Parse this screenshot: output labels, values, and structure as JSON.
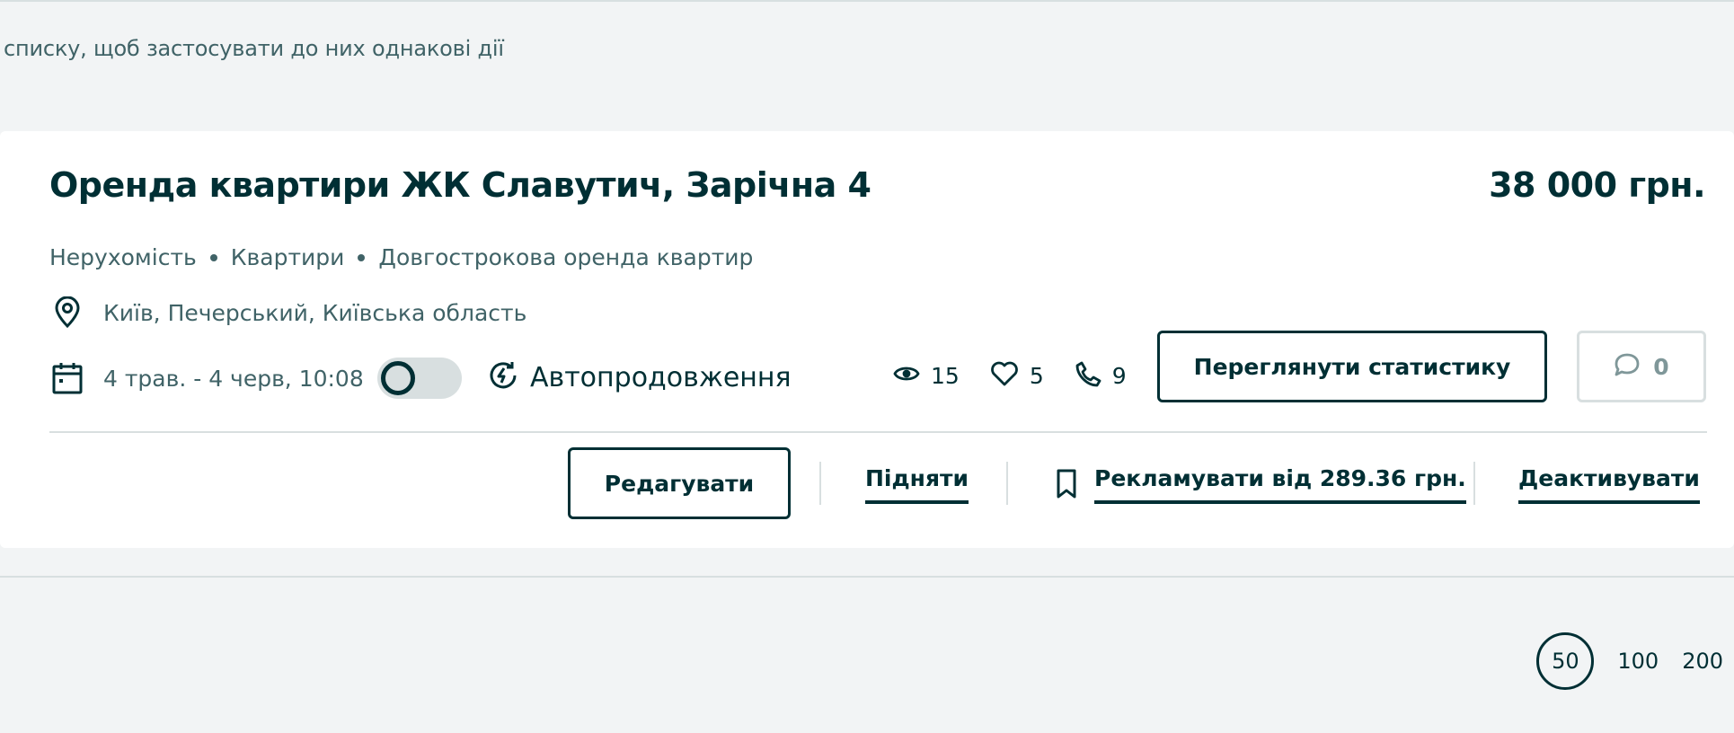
{
  "hint_text": "списку, щоб застосувати до них однакові дії",
  "listing": {
    "title": "Оренда квартири ЖК Славутич, Зарічна 4",
    "price": "38 000 грн.",
    "breadcrumbs": [
      "Нерухомість",
      "Квартири",
      "Довгострокова оренда квартир"
    ],
    "location": "Київ, Печерський, Київська область",
    "dates": "4 трав. - 4 черв, 10:08",
    "autorenew_label": "Автопродовження",
    "autorenew_enabled": false,
    "stats": {
      "views": "15",
      "favorites": "5",
      "calls": "9"
    },
    "messages_count": "0",
    "buttons": {
      "view_stats": "Переглянути статистику",
      "edit": "Редагувати",
      "raise": "Підняти",
      "promote": "Рекламувати від 289.36 грн.",
      "deactivate": "Деактивувати"
    }
  },
  "page_size": {
    "options": [
      "50",
      "100",
      "200"
    ],
    "selected": "50"
  },
  "icons": [
    "location-pin-icon",
    "calendar-icon",
    "autorenew-icon",
    "eye-icon",
    "heart-icon",
    "phone-icon",
    "chat-bubble-icon",
    "bookmark-icon"
  ],
  "colors": {
    "text_primary": "#002f34",
    "text_secondary": "#406367",
    "border_light": "#d8dfe0",
    "background": "#f2f4f5"
  }
}
